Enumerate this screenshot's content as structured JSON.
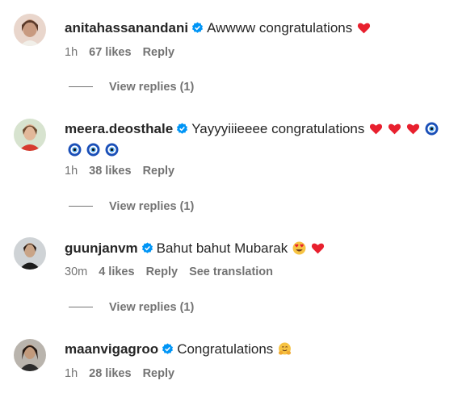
{
  "comments": [
    {
      "username": "anitahassanandani",
      "text": "Awwww congratulations",
      "emojis": [
        "red-heart"
      ],
      "time": "1h",
      "likes": "67 likes",
      "reply": "Reply",
      "view_replies": "View replies (1)"
    },
    {
      "username": "meera.deosthale",
      "text": "Yayyyiiieeee congratulations",
      "emojis": [
        "red-heart",
        "red-heart",
        "red-heart",
        "nazar-amulet",
        "nazar-amulet",
        "nazar-amulet",
        "nazar-amulet"
      ],
      "time": "1h",
      "likes": "38 likes",
      "reply": "Reply",
      "view_replies": "View replies (1)"
    },
    {
      "username": "guunjanvm",
      "text": "Bahut bahut Mubarak",
      "emojis": [
        "heart-eyes-face",
        "red-heart"
      ],
      "time": "30m",
      "likes": "4 likes",
      "reply": "Reply",
      "see_translation": "See translation",
      "view_replies": "View replies (1)"
    },
    {
      "username": "maanvigagroo",
      "text": "Congratulations",
      "emojis": [
        "hugging-face"
      ],
      "time": "1h",
      "likes": "28 likes",
      "reply": "Reply"
    }
  ],
  "colors": {
    "verified_blue": "#0095f6",
    "meta_gray": "#737373",
    "heart_red": "#e8202e",
    "nazar_blue": "#1a4fb8"
  }
}
